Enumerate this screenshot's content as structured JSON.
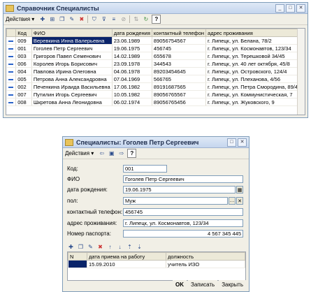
{
  "main_window": {
    "title": "Справочник Специалисты",
    "actions_label": "Действия ▾",
    "help_label": "?",
    "columns": [
      "Код",
      "ФИО",
      "дата рождения",
      "контактный телефон",
      "адрес проживания"
    ],
    "rows": [
      {
        "code": "009",
        "fio": "Веревкина Инна Валерьевна",
        "dob": "23.06.1989",
        "phone": "89056754567",
        "address": "г. Липецк, ул. Белана, 78/2"
      },
      {
        "code": "001",
        "fio": "Гоголев Петр Сергеевич",
        "dob": "19.06.1975",
        "phone": "456745",
        "address": "г. Липецк, ул. Космонавтов, 123/34"
      },
      {
        "code": "003",
        "fio": "Григоров Павел Семенович",
        "dob": "14.02.1989",
        "phone": "655678",
        "address": "г. Липецк, ул. Терешковой 34/45"
      },
      {
        "code": "006",
        "fio": "Королев Игорь Борисович",
        "dob": "23.09.1978",
        "phone": "344543",
        "address": "г. Липецк, ул. 40 лет октября, 45/8"
      },
      {
        "code": "004",
        "fio": "Павлова Ирина Олеговна",
        "dob": "04.06.1978",
        "phone": "89203454645",
        "address": "г. Липецк, ул. Островского, 124/4"
      },
      {
        "code": "005",
        "fio": "Петрова Анна Александровна",
        "dob": "07.04.1969",
        "phone": "566765",
        "address": "г. Липецк, ул. Плеханова, 4/56"
      },
      {
        "code": "002",
        "fio": "Печенкина Ираида Васильевна",
        "dob": "17.06.1982",
        "phone": "89191687565",
        "address": "г. Липецк, ул. Петра Смородина, 89/4"
      },
      {
        "code": "007",
        "fio": "Путилин Игорь Сергеевич",
        "dob": "10.05.1982",
        "phone": "89056765567",
        "address": "г. Липецк, ул. Коммунистическая, 7"
      },
      {
        "code": "008",
        "fio": "Шкретова Анна Леонидовна",
        "dob": "06.02.1974",
        "phone": "89056765456",
        "address": "г. Липецк, ул. Жуковского, 9"
      }
    ]
  },
  "dialog": {
    "title": "Специалисты: Гоголев Петр Сергеевич",
    "actions_label": "Действия ▾",
    "help_label": "?",
    "fields": {
      "code_label": "Код:",
      "code_value": "001",
      "fio_label": "ФИО",
      "fio_value": "Гоголев Петр Сергеевич",
      "dob_label": "дата рождения:",
      "dob_value": "19.06.1975",
      "gender_label": "пол:",
      "gender_value": "Муж",
      "phone_label": "контактный телефон:",
      "phone_value": "456745",
      "address_label": "адрес проживания:",
      "address_value": "г. Липецк, ул. Космонавтов, 123/34",
      "passport_label": "Номер паспорта:",
      "passport_value": "4 567 345 445"
    },
    "sub_columns": [
      "N",
      "дата приема на работу",
      "должность"
    ],
    "sub_rows": [
      {
        "n": "1",
        "date": "15.09.2010",
        "position": "учитель ИЗО"
      }
    ],
    "buttons": {
      "ok": "OK",
      "save": "Записать",
      "close": "Закрыть"
    }
  }
}
